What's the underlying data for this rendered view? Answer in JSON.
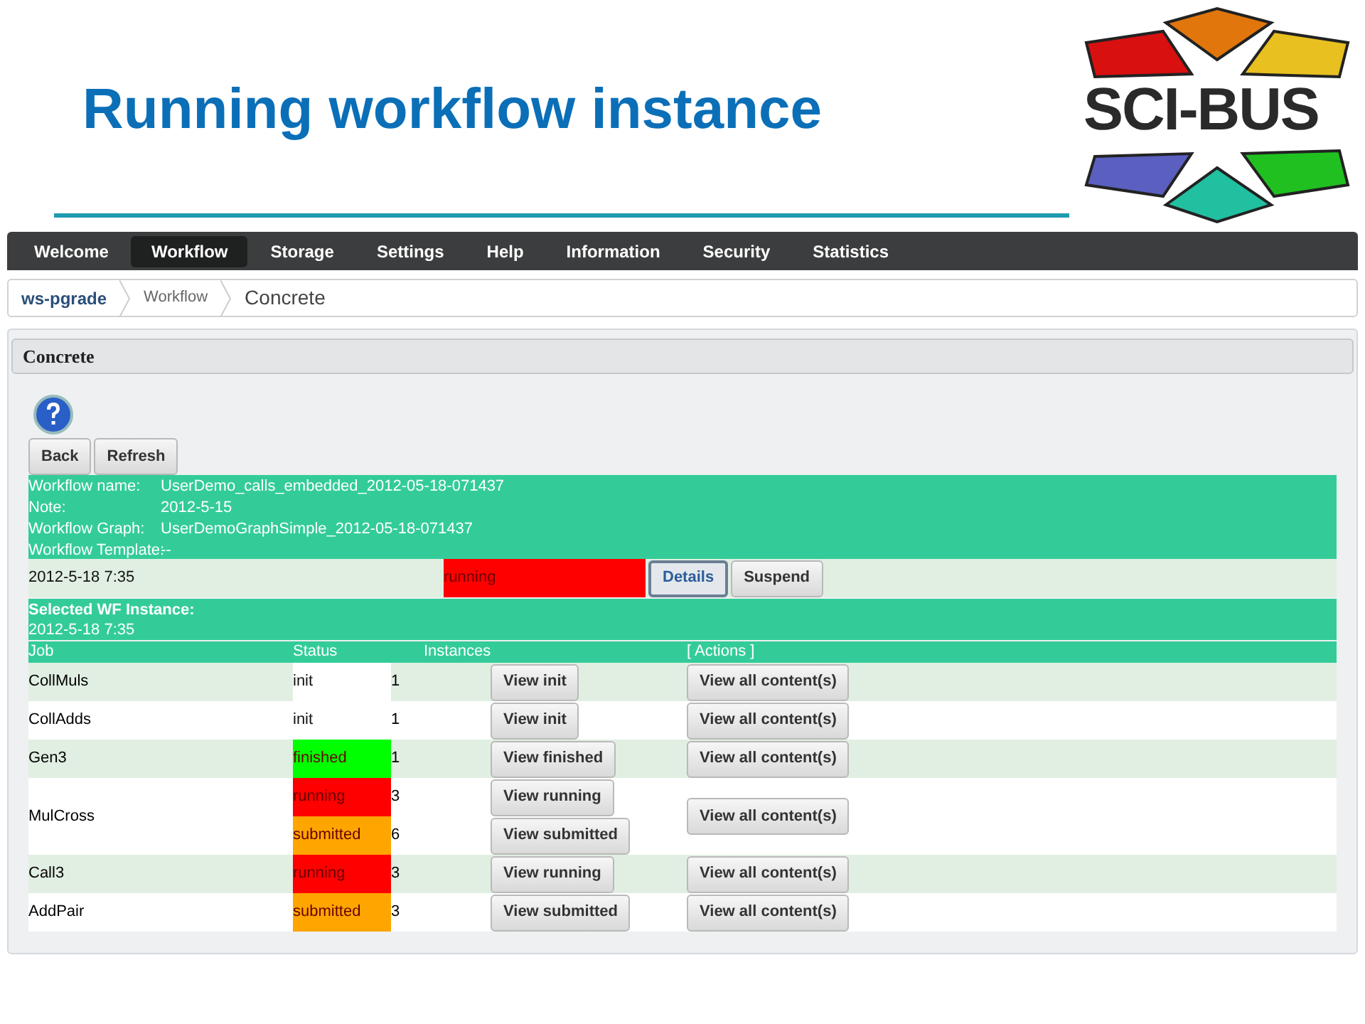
{
  "slide_title": "Running workflow instance",
  "logo": {
    "text": "SCI-BUS"
  },
  "nav": [
    {
      "label": "Welcome",
      "selected": false
    },
    {
      "label": "Workflow",
      "selected": true
    },
    {
      "label": "Storage",
      "selected": false
    },
    {
      "label": "Settings",
      "selected": false
    },
    {
      "label": "Help",
      "selected": false
    },
    {
      "label": "Information",
      "selected": false
    },
    {
      "label": "Security",
      "selected": false
    },
    {
      "label": "Statistics",
      "selected": false
    }
  ],
  "breadcrumb": [
    "ws-pgrade",
    "Workflow",
    "Concrete"
  ],
  "panel": {
    "title": "Concrete",
    "buttons": [
      "Back",
      "Refresh"
    ],
    "info": [
      {
        "label": "Workflow name:",
        "value": "UserDemo_calls_embedded_2012-05-18-071437"
      },
      {
        "label": "Note:",
        "value": "2012-5-15"
      },
      {
        "label": "Workflow Graph:",
        "value": "UserDemoGraphSimple_2012-05-18-071437"
      },
      {
        "label": "Workflow Template:",
        "value": "--"
      }
    ],
    "instance": {
      "date": "2012-5-18 7:35",
      "status": "running",
      "color": "#ff0000",
      "buttons": [
        {
          "label": "Details",
          "selected": true
        },
        {
          "label": "Suspend",
          "selected": false
        }
      ]
    },
    "selected_instance": {
      "title": "Selected WF Instance:",
      "date": "2012-5-18 7:35"
    },
    "columns": [
      "Job",
      "Status",
      "Instances",
      "[ Actions ]"
    ],
    "jobs": [
      {
        "name": "CollMuls",
        "entries": [
          {
            "status": "init",
            "color": "#ffffff",
            "instances": "1",
            "button": "View init"
          }
        ],
        "action": "View all content(s)"
      },
      {
        "name": "CollAdds",
        "entries": [
          {
            "status": "init",
            "color": "#ffffff",
            "instances": "1",
            "button": "View init"
          }
        ],
        "action": "View all content(s)"
      },
      {
        "name": "Gen3",
        "entries": [
          {
            "status": "finished",
            "color": "#00ff00",
            "instances": "1",
            "button": "View finished"
          }
        ],
        "action": "View all content(s)"
      },
      {
        "name": "MulCross",
        "entries": [
          {
            "status": "running",
            "color": "#ff0000",
            "instances": "3",
            "button": "View running"
          },
          {
            "status": "submitted",
            "color": "#ffa500",
            "instances": "6",
            "button": "View submitted"
          }
        ],
        "action": "View all content(s)"
      },
      {
        "name": "Call3",
        "entries": [
          {
            "status": "running",
            "color": "#ff0000",
            "instances": "3",
            "button": "View running"
          }
        ],
        "action": "View all content(s)"
      },
      {
        "name": "AddPair",
        "entries": [
          {
            "status": "submitted",
            "color": "#ffa500",
            "instances": "3",
            "button": "View submitted"
          }
        ],
        "action": "View all content(s)"
      }
    ]
  }
}
